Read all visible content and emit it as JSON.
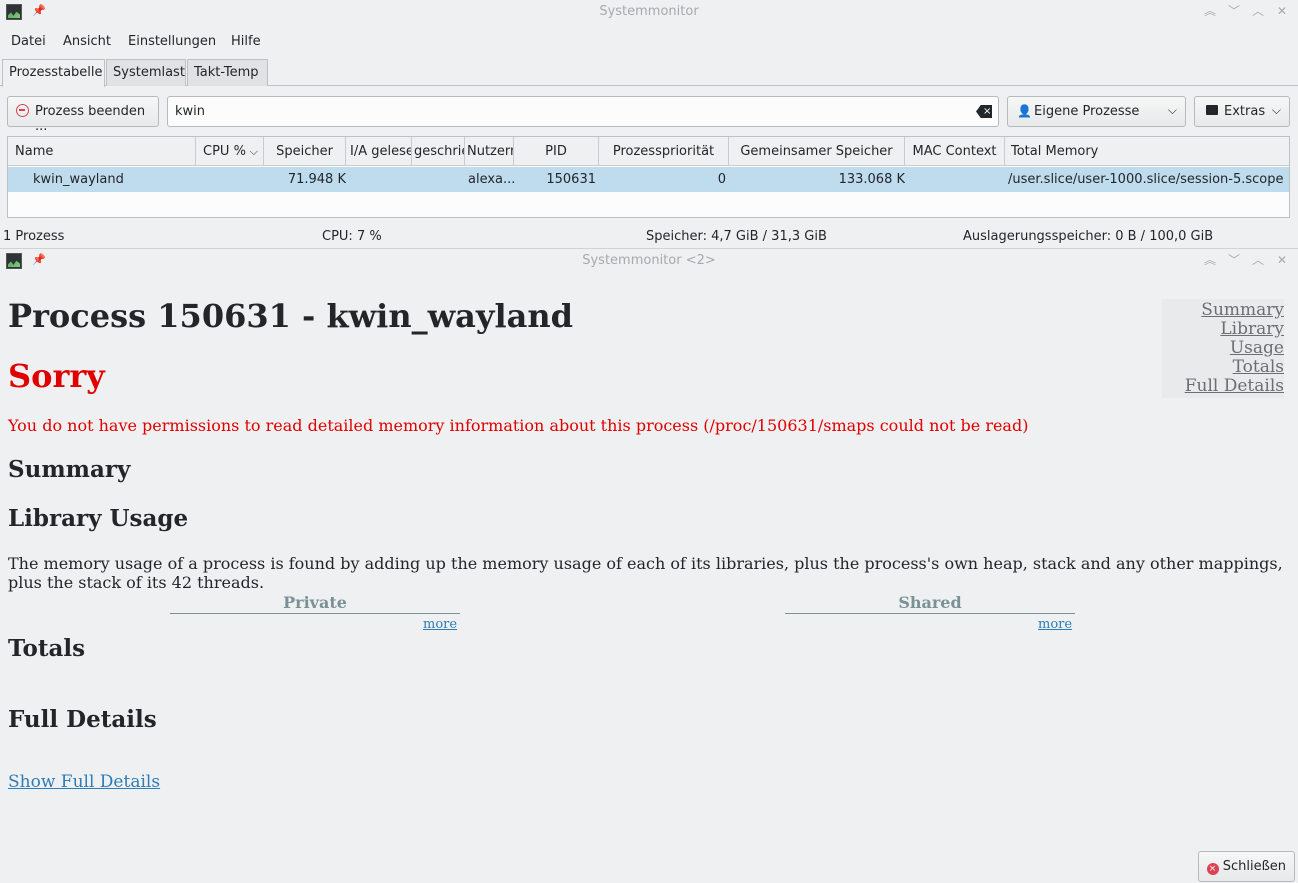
{
  "window1": {
    "title": "Systemmonitor",
    "menu": [
      "Datei",
      "Ansicht",
      "Einstellungen",
      "Hilfe"
    ],
    "tabs": [
      "Prozesstabelle",
      "Systemlast",
      "Takt-Temp"
    ],
    "toolbar": {
      "end_process_label": "Prozess beenden ...",
      "search_value": "kwin",
      "filter_label": "Eigene Prozesse",
      "extras_label": "Extras"
    },
    "table": {
      "columns": [
        "Name",
        "CPU %",
        "Speicher",
        "I/A gelese",
        "geschrie",
        "Nutzern",
        "PID",
        "Prozesspriorität",
        "Gemeinsamer Speicher",
        "MAC Context",
        "Total Memory"
      ],
      "rows": [
        {
          "name": "kwin_wayland",
          "cpu": "",
          "memory": "71.948 K",
          "io_read": "",
          "io_write": "",
          "user": "alexa...",
          "pid": "150631",
          "priority": "0",
          "shared": "133.068 K",
          "mac": "",
          "total": "/user.slice/user-1000.slice/session-5.scope"
        }
      ]
    },
    "status": {
      "processes": "1 Prozess",
      "cpu": "CPU: 7 %",
      "memory": "Speicher: 4,7 GiB / 31,3 GiB",
      "swap": "Auslagerungsspeicher: 0 B / 100,0 GiB"
    }
  },
  "window2": {
    "title": "Systemmonitor <2>",
    "heading": "Process 150631 - kwin_wayland",
    "sorry": "Sorry",
    "error": "You do not have permissions to read detailed memory information about this process (/proc/150631/smaps could not be read)",
    "summary_heading": "Summary",
    "library_heading": "Library Usage",
    "library_text": "The memory usage of a process is found by adding up the memory usage of each of its libraries, plus the process's own heap, stack and any other mappings, plus the stack of its 42 threads.",
    "private_label": "Private",
    "shared_label": "Shared",
    "more_label": "more",
    "totals_heading": "Totals",
    "full_details_heading": "Full Details",
    "show_full_details": "Show Full Details",
    "nav": [
      "Summary",
      "Library Usage",
      "Totals",
      "Full Details"
    ],
    "close_label": "Schließen"
  },
  "colors": {
    "selection": "#bfdcef",
    "error_red": "#e00000",
    "link_blue": "#2e7cb8",
    "column_head": "#7a9196"
  }
}
